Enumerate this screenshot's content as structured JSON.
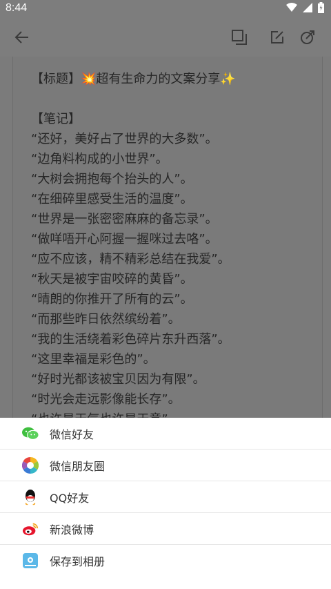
{
  "status": {
    "time": "8:44"
  },
  "note": {
    "lines": [
      "【标题】💥超有生命力的文案分享✨",
      "",
      "【笔记】",
      "“还好，美好占了世界的大多数”。",
      "“边角料构成的小世界”。",
      "“大树会拥抱每个抬头的人”。",
      "“在细碎里感受生活的温度”。",
      "“世界是一张密密麻麻的备忘录”。",
      "“做咩唔开心阿握一握咪过去咯”。",
      "“应不应该，精不精彩总结在我爱”。",
      "“秋天是被宇宙咬碎的黄昏”。",
      "“晴朗的你推开了所有的云”。",
      "“而那些昨日依然缤纷着”。",
      "“我的生活绕着彩色碎片东升西落”。",
      "“这里幸福是彩色的”。",
      "“好时光都该被宝贝因为有限”。",
      "“时光会走远影像能长存”。",
      "“也许是天气也许是天意”"
    ]
  },
  "share": {
    "items": [
      {
        "label": "微信好友",
        "icon": "wechat-icon"
      },
      {
        "label": "微信朋友圈",
        "icon": "moments-icon"
      },
      {
        "label": "QQ好友",
        "icon": "qq-icon"
      },
      {
        "label": "新浪微博",
        "icon": "weibo-icon"
      },
      {
        "label": "保存到相册",
        "icon": "album-icon"
      }
    ]
  }
}
